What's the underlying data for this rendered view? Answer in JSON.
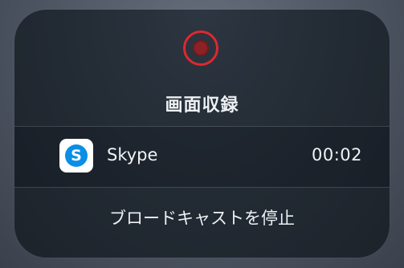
{
  "recording": {
    "title": "画面収録",
    "app": {
      "name": "Skype",
      "icon": "skype-icon",
      "logo_letter": "S",
      "elapsed": "00:02"
    },
    "stop_label": "ブロードキャストを停止"
  },
  "colors": {
    "record_ring": "#e0272f",
    "record_dot": "#8d2226",
    "skype_blue": "#0a8ee6",
    "panel": "#222a33"
  }
}
